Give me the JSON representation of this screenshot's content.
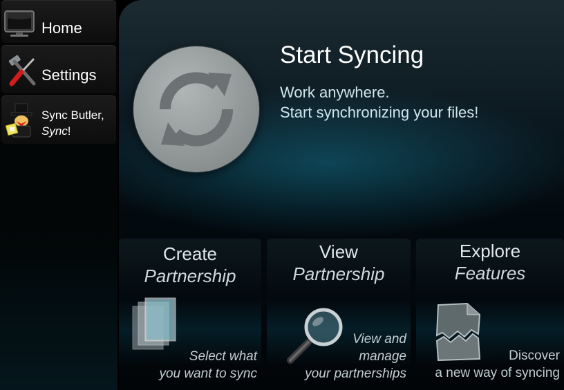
{
  "sidebar": {
    "home_label": "Home",
    "settings_label": "Settings",
    "butler_line1": "Sync Butler,",
    "butler_line2": "Sync",
    "butler_line2_suffix": "!"
  },
  "main": {
    "title": "Start Syncing",
    "subtitle_line1": "Work anywhere.",
    "subtitle_line2": "Start synchronizing your files!"
  },
  "cards": {
    "create": {
      "title_line1": "Create",
      "title_line2": "Partnership",
      "desc_line1": "Select what",
      "desc_line2": "you want to sync"
    },
    "view": {
      "title_line1": "View",
      "title_line2": "Partnership",
      "desc_line1": "View and",
      "desc_line2": "manage",
      "desc_line3": "your partnerships"
    },
    "explore": {
      "title_line1": "Explore",
      "title_line2": "Features",
      "desc_line1": "Discover",
      "desc_line2": "a new way of syncing"
    }
  },
  "icons": {
    "home": "monitor-icon",
    "settings": "wrench-screwdriver-icon",
    "butler": "butler-mascot-icon",
    "sync": "sync-arrows-icon",
    "create": "documents-icon",
    "view": "magnifier-icon",
    "explore": "torn-paper-icon"
  },
  "colors": {
    "accent": "#0f5f76",
    "sync_button": "#939999"
  }
}
